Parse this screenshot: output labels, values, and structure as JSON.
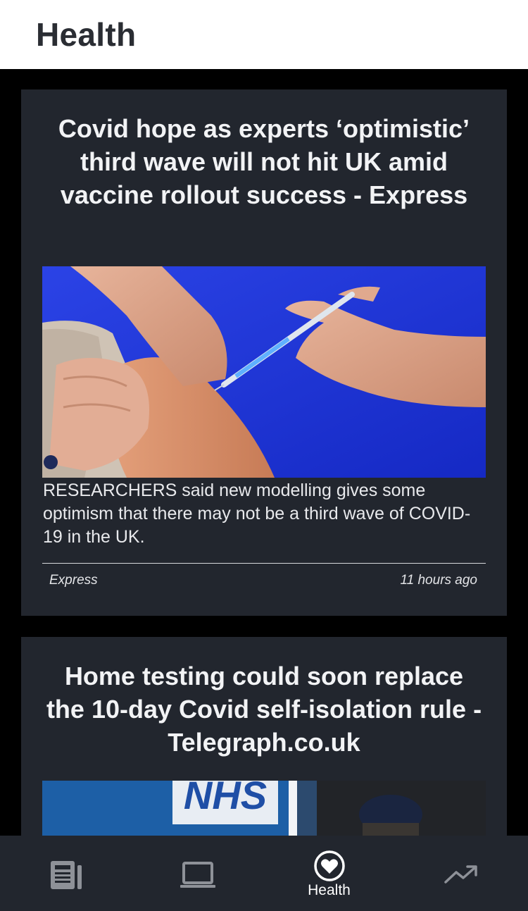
{
  "header": {
    "title": "Health"
  },
  "articles": [
    {
      "title": "Covid hope as experts ‘optimistic’ third wave will not hit UK amid vaccine rollout success - Express",
      "summary": "RESEARCHERS said new modelling gives some optimism that there may not be a third wave of COVID-19 in the UK.",
      "source": "Express",
      "time": "11 hours ago",
      "image": "photo-vaccine-injection"
    },
    {
      "title": "Home testing could soon replace the 10-day Covid self-isolation rule - Telegraph.co.uk",
      "image": "photo-nhs-sign-and-person"
    }
  ],
  "tabbar": {
    "tabs": [
      {
        "icon": "newspaper-icon",
        "label": "",
        "active": false
      },
      {
        "icon": "laptop-icon",
        "label": "",
        "active": false
      },
      {
        "icon": "heart-icon",
        "label": "Health",
        "active": true
      },
      {
        "icon": "trending-icon",
        "label": "",
        "active": false
      }
    ]
  },
  "colors": {
    "header_bg": "#ffffff",
    "card_bg": "#22262e",
    "page_bg": "#000000",
    "inactive_icon": "#8e9198",
    "active_icon": "#ffffff"
  }
}
